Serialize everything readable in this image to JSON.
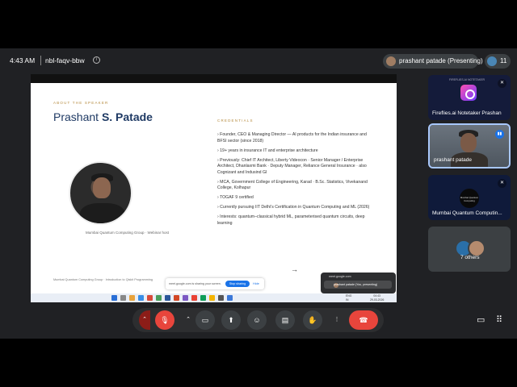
{
  "topbar": {
    "time": "4:43 AM",
    "meeting_code": "nbl-faqv-bbw",
    "presenter_chip": "prashant patade (Presenting)",
    "participant_count": "11"
  },
  "slide": {
    "eyebrow": "ABOUT THE SPEAKER",
    "name_first": "Prashant ",
    "name_last": "S. Patade",
    "photo_caption": "Mumbai Quantum Computing Group · Webinar host",
    "credentials_title": "CREDENTIALS",
    "credentials": [
      "› Founder, CEO & Managing Director — AI products for the Indian insurance and BFSI sector (since 2018)",
      "› 19+ years in insurance IT and enterprise architecture",
      "› Previously: Chief IT Architect, Liberty Videocon · Senior Manager / Enterprise Architect, Dhanlaxmi Bank · Deputy Manager, Reliance General Insurance · also Cognizant and Indusind GI",
      "› MCA, Government College of Engineering, Karad · B.Sc. Statistics, Vivekanand College, Kolhapur",
      "› TOGAF 9 certified",
      "› Currently pursuing IIT Delhi's Certification in Quantum Computing and ML (2026)",
      "› Interests: quantum–classical hybrid ML, parameterised quantum circuits, deep learning"
    ],
    "arrow": "→",
    "footer": "Mumbai Quantum Computing Group · Introduction to Qiskit Programming"
  },
  "share_banner": {
    "text": "meet.google.com is sharing your screen.",
    "stop_label": "Stop sharing",
    "hide_label": "Hide"
  },
  "popup": {
    "url": "meet.google.com",
    "item": "prashant patade (You, presenting)"
  },
  "taskbar": {
    "lang": "ENG\nIN",
    "clock": "04:43\n29-03-2026"
  },
  "tiles": [
    {
      "name": "Fireflies.ai Notetaker Prashan",
      "top_text": "FIREFLIES.AI NOTETAKER"
    },
    {
      "name": "prashant patade"
    },
    {
      "name": "Mumbai Quantum Computin...",
      "logo_text": "Mumbai Quantum Computing"
    },
    {
      "name": "7 others"
    }
  ],
  "icons": {
    "info": "info-icon",
    "mic_off": "mic-off-icon",
    "camera": "camera-icon",
    "present": "present-icon",
    "emoji": "emoji-icon",
    "captions": "captions-icon",
    "hand": "raise-hand-icon",
    "more": "more-vert-icon",
    "end_call": "end-call-icon",
    "chat": "chat-icon",
    "activities": "activities-icon"
  },
  "colors": {
    "meet_bg": "#202124",
    "end_call": "#e8453c",
    "accent": "#1a73e8",
    "slide_accent": "#b58a3e",
    "name_color": "#1f3a64"
  }
}
